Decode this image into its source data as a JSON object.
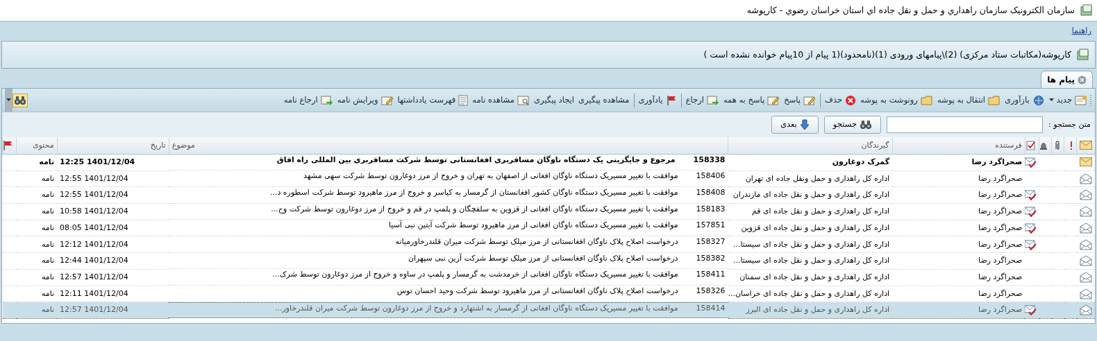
{
  "window": {
    "title": "سازمان الکترونيک سازمان راهداري و حمل و نقل جاده اي استان خراسان رضوي - کارپوشه"
  },
  "menu": {
    "help": "راهنما"
  },
  "breadcrumb": "کارپوشه(مکاتبات ستاد مرکزی) (2)\\پیامهای ورودی (1)(نامحدود)(1 پیام از 10پیام خوانده نشده است )",
  "tabs": [
    {
      "label": "پیام ها",
      "selected": true
    }
  ],
  "toolbar": [
    {
      "kind": "dropdown",
      "label": "جدید"
    },
    {
      "kind": "button",
      "label": "بازآوری"
    },
    {
      "kind": "button",
      "label": "انتقال به پوشه"
    },
    {
      "kind": "button",
      "label": "رونوشت به پوشه"
    },
    {
      "kind": "button",
      "label": "حذف"
    },
    {
      "kind": "separator"
    },
    {
      "kind": "button",
      "label": "پاسخ"
    },
    {
      "kind": "button",
      "label": "پاسخ به همه"
    },
    {
      "kind": "button",
      "label": "ارجاع"
    },
    {
      "kind": "separator"
    },
    {
      "kind": "button",
      "label": "یادآوری"
    },
    {
      "kind": "separator"
    },
    {
      "kind": "button",
      "label": "مشاهده پیگیری"
    },
    {
      "kind": "button",
      "label": "ایجاد پیگیری"
    },
    {
      "kind": "button",
      "label": "مشاهده نامه"
    },
    {
      "kind": "button",
      "label": "فهرست یادداشتها"
    },
    {
      "kind": "button",
      "label": "ویرایش نامه"
    },
    {
      "kind": "button",
      "label": "ارجاع نامه"
    }
  ],
  "search": {
    "label": "متن جستجو :",
    "search_button": "جستجو",
    "next_button": "بعدی"
  },
  "table": {
    "columns": [
      "فرستنده",
      "گیرندگان",
      "موضوع",
      "تاریخ",
      "محتوی"
    ],
    "rows": [
      {
        "unread": true,
        "answered": true,
        "selected": false,
        "sender": "صحراگرد رضا",
        "recipient": "گمرک دوغارون",
        "number": "158338",
        "subject": "مرجوع و جایگزینی یک دستگاه ناوگان مسافربری افغانستانی  توسط شرکت مسافربری بین المللی راه افاق",
        "date": "1401/12/04 12:25",
        "content": "نامه"
      },
      {
        "unread": false,
        "answered": false,
        "selected": false,
        "sender": "صحراگرد رضا",
        "recipient": "اداره کل راهداری و حمل ونقل جاده ای تهران",
        "number": "158406",
        "subject": "موافقت با تغییر مسیریک دستگاه ناوگان افغانی از اصفهان به تهران و خروج از مرز دوغارون توسط شرکت سهی مشهد",
        "date": "1401/12/04 12:55",
        "content": "نامه"
      },
      {
        "unread": false,
        "answered": true,
        "selected": false,
        "sender": "صحراگرد رضا",
        "recipient": "اداره کل راهداری و حمل و نقل جاده ای مازندران",
        "number": "158408",
        "subject": "موافقت با تغییر مسیریک دستگاه ناوگان کشور افغانستان از گرمسار به کیاسر و خروج از مرز ماهیرود توسط شرکت اسطوره د...",
        "date": "1401/12/04 12:55",
        "content": "نامه"
      },
      {
        "unread": false,
        "answered": true,
        "selected": false,
        "sender": "صحراگرد رضا",
        "recipient": "اداره کل راهداری و حمل و نقل جاده ای قم",
        "number": "158183",
        "subject": "موافقت با تغییر مسیریک دستگاه ناوگان افغانی از قزوین به سلفچگان و پلمپ در قم و  خروج از مرز دوغارون توسط شرکت وح...",
        "date": "1401/12/04 10:58",
        "content": "نامه"
      },
      {
        "unread": false,
        "answered": true,
        "selected": false,
        "sender": "صحراگرد رضا",
        "recipient": "اداره کل راهداری و حمل و نقل جاده ای قزوین",
        "number": "157851",
        "subject": "موافقت با تغییر مسیریک دستگاه ناوگان افغانی از مرز ماهیرود توسط شرکت آبتین نبی آسیا",
        "date": "1401/12/04 08:05",
        "content": "نامه"
      },
      {
        "unread": false,
        "answered": true,
        "selected": false,
        "sender": "صحراگرد رضا",
        "recipient": "اداره کل راهداری و حمل و نقل جاده ای سیستا...",
        "number": "158327",
        "subject": "درخواست اصلاح پلاک ناوگان افغانستانی از مرز میلک توسط شرکت میران قلندرخاورمیانه",
        "date": "1401/12/04 12:12",
        "content": "نامه"
      },
      {
        "unread": false,
        "answered": false,
        "selected": false,
        "sender": "صحراگرد رضا",
        "recipient": "اداره کل راهداری و حمل و نقل جاده ای سیستا...",
        "number": "158382",
        "subject": "درخواست اصلاح پلاک ناوگان افغانستانی از مرز میلک توسط شرکت آرین نبی سپهران",
        "date": "1401/12/04 12:44",
        "content": "نامه"
      },
      {
        "unread": false,
        "answered": false,
        "selected": false,
        "sender": "صحراگرد رضا",
        "recipient": "اداره کل راهداری و حمل و نقل جاده ای سمنان",
        "number": "158411",
        "subject": "موافقت با تغییر مسیریک دستگاه ناوگان افغانی از خرمدشت به گرمسار و پلمپ در ساوه و  خروج از مرز دوغارون توسط شرک...",
        "date": "1401/12/04 12:57",
        "content": "نامه"
      },
      {
        "unread": false,
        "answered": false,
        "selected": false,
        "sender": "صحراگرد رضا",
        "recipient": "اداره کل راهداری و حمل و نقل جاده ای خراسان...",
        "number": "158326",
        "subject": "درخواست اصلاح پلاک ناوگان افغانستانی از مرز ماهیرود توسط شرکت وحید احسان توس",
        "date": "1401/12/04 12:11",
        "content": "نامه"
      },
      {
        "unread": false,
        "answered": true,
        "selected": true,
        "sender": "صحراگرد رضا",
        "recipient": "اداره کل راهداری و حمل و نقل جاده ای البرز",
        "number": "158414",
        "subject": "موافقت با تغییر مسیریک دستگاه ناوگان افغانی از گرمسار به اشتهارد  و  خروج از مرز دوغارون توسط شرکت میران قلندرخاور...",
        "date": "1401/12/04 12:57",
        "content": "نامه"
      }
    ]
  }
}
